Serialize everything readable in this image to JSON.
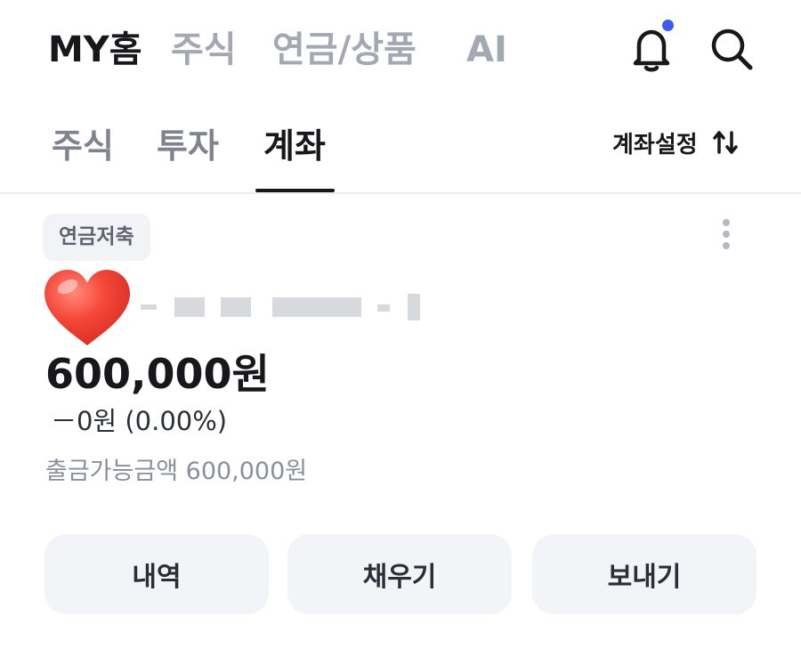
{
  "top_nav": {
    "tabs": [
      {
        "label": "MY홈",
        "active": true
      },
      {
        "label": "주식",
        "active": false
      },
      {
        "label": "연금/상품",
        "active": false
      },
      {
        "label": "AI",
        "active": false
      }
    ],
    "notification_icon": "bell-icon",
    "notification_dot_color": "#3d5af1",
    "search_icon": "search-icon"
  },
  "sub_nav": {
    "tabs": [
      {
        "label": "주식",
        "active": false
      },
      {
        "label": "투자",
        "active": false
      },
      {
        "label": "계좌",
        "active": true
      }
    ],
    "settings_label": "계좌설정",
    "settings_icon": "sort-arrows-icon"
  },
  "account": {
    "badge": "연금저축",
    "more_icon": "more-vertical-icon",
    "avatar_icon": "heart-icon",
    "balance": "600,000원",
    "change": "－0원 (0.00%)",
    "withdrawable_label": "출금가능금액",
    "withdrawable_amount": "600,000원"
  },
  "actions": [
    {
      "label": "내역"
    },
    {
      "label": "채우기"
    },
    {
      "label": "보내기"
    }
  ],
  "colors": {
    "text_primary": "#17171c",
    "text_inactive": "#a4a8b2",
    "button_bg": "#f3f4f7",
    "accent": "#3d5af1"
  }
}
